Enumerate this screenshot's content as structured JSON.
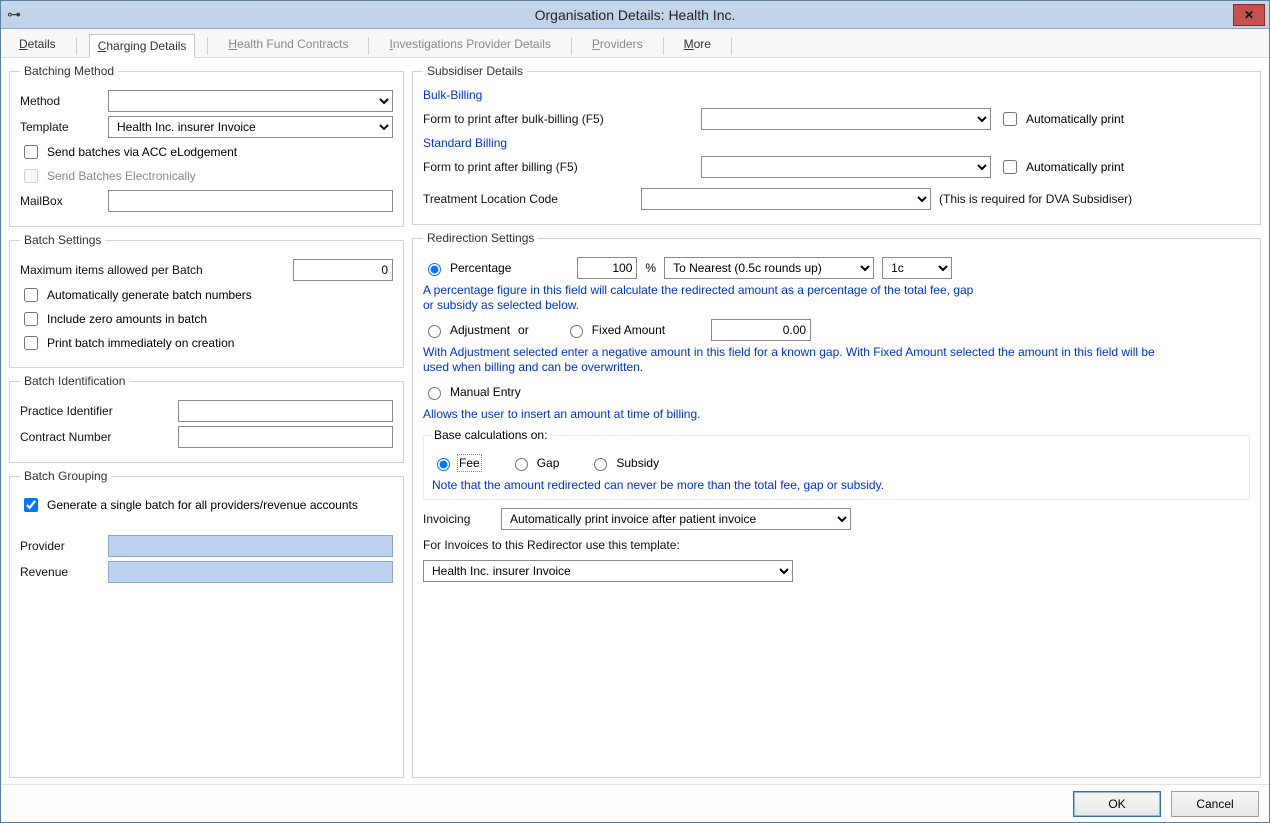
{
  "window": {
    "title": "Organisation Details: Health Inc."
  },
  "tabs": {
    "details": "Details",
    "charging": "Charging Details",
    "hfc": "Health Fund Contracts",
    "ipd": "Investigations Provider Details",
    "providers": "Providers",
    "more": "More"
  },
  "batching_method": {
    "legend": "Batching Method",
    "method_label": "Method",
    "method_value": "",
    "template_label": "Template",
    "template_value": "Health Inc. insurer Invoice",
    "cb_acc": "Send batches via ACC eLodgement",
    "cb_elec": "Send Batches Electronically",
    "mailbox_label": "MailBox",
    "mailbox_value": ""
  },
  "batch_settings": {
    "legend": "Batch Settings",
    "max_label": "Maximum items allowed per Batch",
    "max_value": "0",
    "cb_auto_nums": "Automatically generate batch numbers",
    "cb_zero": "Include zero amounts in batch",
    "cb_print": "Print batch immediately on creation"
  },
  "batch_id": {
    "legend": "Batch Identification",
    "practice_label": "Practice Identifier",
    "practice_value": "",
    "contract_label": "Contract Number",
    "contract_value": ""
  },
  "batch_grouping": {
    "legend": "Batch Grouping",
    "cb_single": "Generate a single batch for all providers/revenue accounts",
    "provider_label": "Provider",
    "revenue_label": "Revenue"
  },
  "subsidiser": {
    "legend": "Subsidiser Details",
    "bulk_header": "Bulk-Billing",
    "bulk_form_label": "Form to print after bulk-billing (F5)",
    "bulk_form_value": "",
    "bulk_auto": "Automatically print",
    "std_header": "Standard Billing",
    "std_form_label": "Form to print after billing (F5)",
    "std_form_value": "",
    "std_auto": "Automatically print",
    "tlc_label": "Treatment Location Code",
    "tlc_value": "",
    "tlc_note": "(This is required for DVA Subsidiser)"
  },
  "redirection": {
    "legend": "Redirection Settings",
    "percentage_label": "Percentage",
    "percentage_value": "100",
    "percent_unit": "%",
    "rounding_value": "To Nearest (0.5c rounds up)",
    "rounding_step": "1c",
    "percentage_note": "A percentage figure in this field will calculate the redirected amount as a percentage of the total fee, gap or subsidy as selected below.",
    "adjustment_label": "Adjustment",
    "or_text": "or",
    "fixed_label": "Fixed Amount",
    "amount_value": "0.00",
    "adjustment_note": "With Adjustment selected enter a negative amount in this field for a known gap. With Fixed Amount selected the amount in this field will be used when billing and can be overwritten.",
    "manual_label": "Manual Entry",
    "manual_note": "Allows the user to insert an amount at time of billing.",
    "base_legend": "Base calculations on:",
    "base_fee": "Fee",
    "base_gap": "Gap",
    "base_subsidy": "Subsidy",
    "base_note": "Note that the amount redirected can never be more than the total fee, gap or subsidy.",
    "invoicing_label": "Invoicing",
    "invoicing_value": "Automatically print invoice after patient invoice",
    "template_label": "For Invoices to this Redirector use this template:",
    "template_value": "Health Inc. insurer Invoice"
  },
  "footer": {
    "ok": "OK",
    "cancel": "Cancel"
  }
}
